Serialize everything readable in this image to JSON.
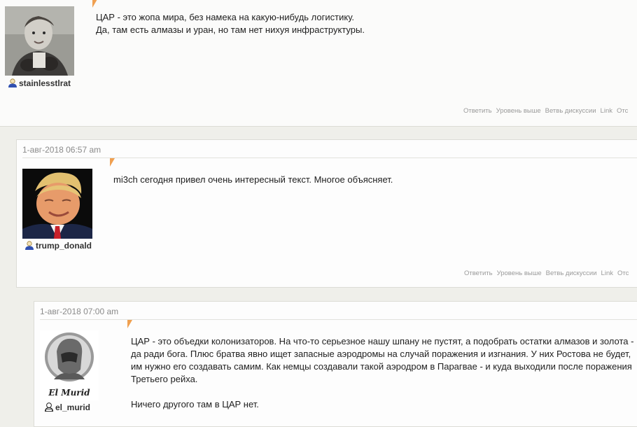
{
  "comments": [
    {
      "username": "stainlesstlrat",
      "text": [
        "ЦАР - это жопа мира, без намека на какую-нибудь логистику.",
        "Да, там есть алмазы и уран, но там нет нихуя инфраструктуры."
      ],
      "actions": [
        "Ответить",
        "Уровень выше",
        "Ветвь дискуссии",
        "Link",
        "Отс"
      ]
    },
    {
      "date": "1-авг-2018 06:57 am",
      "username": "trump_donald",
      "text": [
        "mi3ch сегодня привел очень интересный текст. Многое объясняет."
      ],
      "actions": [
        "Ответить",
        "Уровень выше",
        "Ветвь дискуссии",
        "Link",
        "Отс"
      ]
    },
    {
      "date": "1-авг-2018 07:00 am",
      "username": "el_murid",
      "avatar_caption": "El Murid",
      "text": [
        "ЦАР - это объедки колонизаторов. На что-то серьезное нашу шпану не пустят, а подобрать остатки алмазов и золота - да ради бога. Плюс братва явно ищет запасные аэродромы на случай поражения и изгнания. У них Ростова не будет, им нужно его создавать самим. Как немцы создавали такой аэродром в Парагвае - и куда выходили после поражения Третьего рейха.",
        "Ничего другого там в ЦАР нет."
      ]
    }
  ]
}
